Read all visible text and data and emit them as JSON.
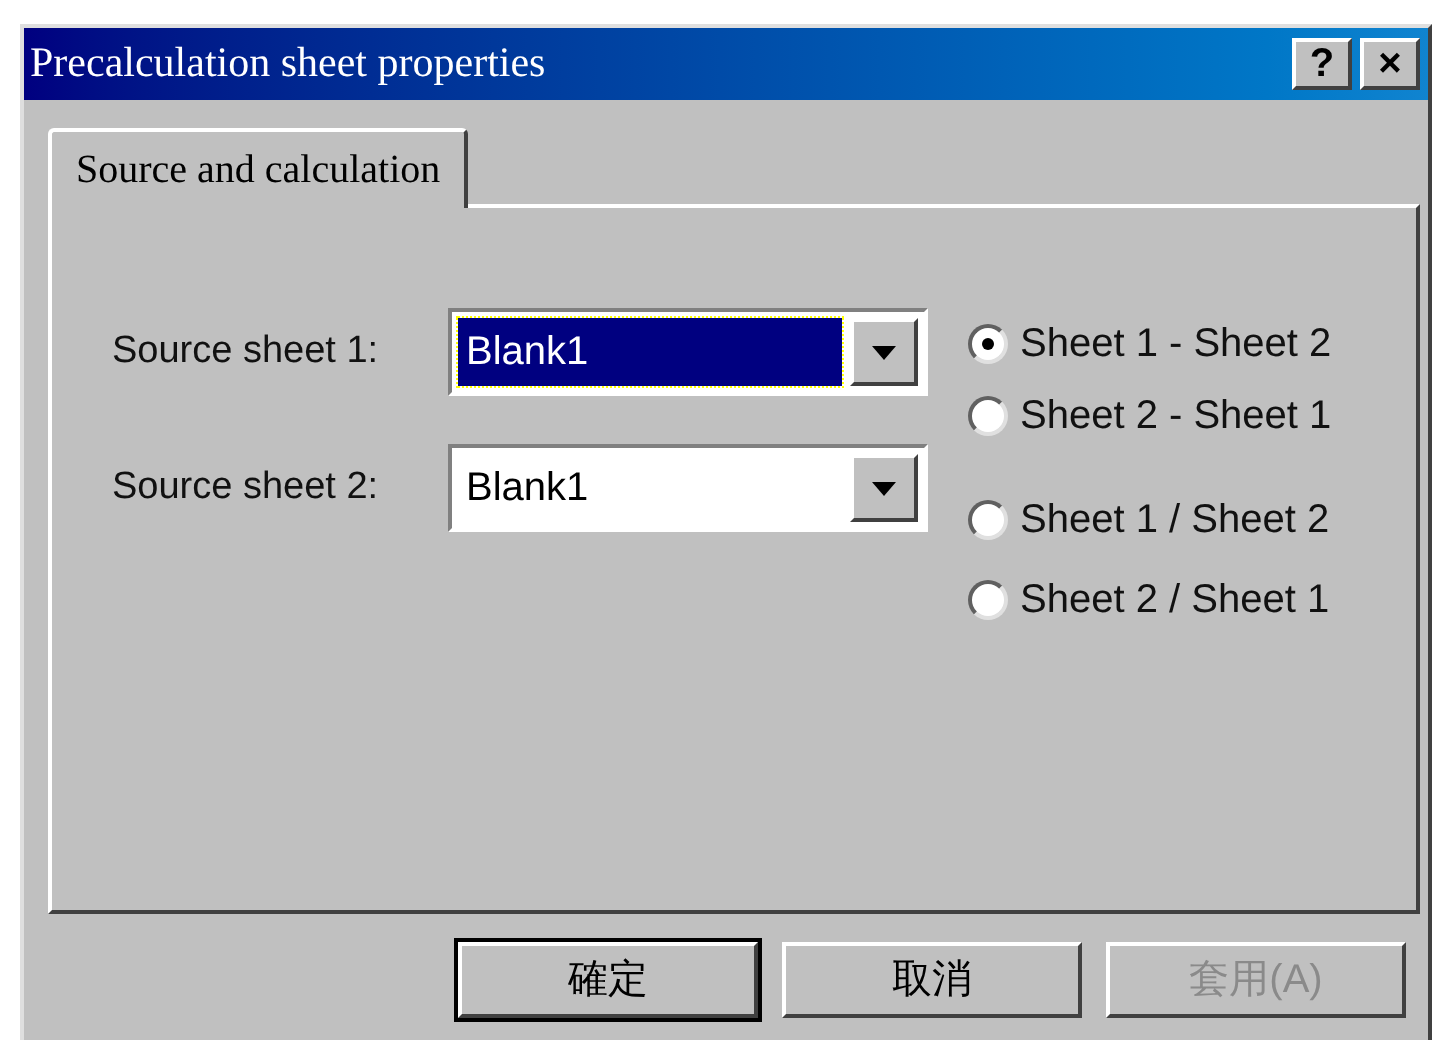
{
  "window": {
    "title": "Precalculation sheet properties",
    "title_buttons": [
      "?",
      "×"
    ]
  },
  "tabs": [
    {
      "label": "Source and calculation",
      "selected": true
    }
  ],
  "fields": [
    {
      "label": "Source sheet 1:",
      "value": "Blank1",
      "focused": true
    },
    {
      "label": "Source sheet 2:",
      "value": "Blank1",
      "focused": false
    }
  ],
  "radios": [
    {
      "label": "Sheet 1 - Sheet 2",
      "selected": true
    },
    {
      "label": "Sheet 2 - Sheet 1",
      "selected": false
    },
    {
      "label": "Sheet 1 / Sheet 2",
      "selected": false
    },
    {
      "label": "Sheet 2 / Sheet 1",
      "selected": false
    }
  ],
  "buttons": [
    {
      "label": "確定",
      "default": true,
      "disabled": false
    },
    {
      "label": "取消",
      "default": false,
      "disabled": false
    },
    {
      "label": "套用(A)",
      "default": false,
      "disabled": true
    }
  ]
}
